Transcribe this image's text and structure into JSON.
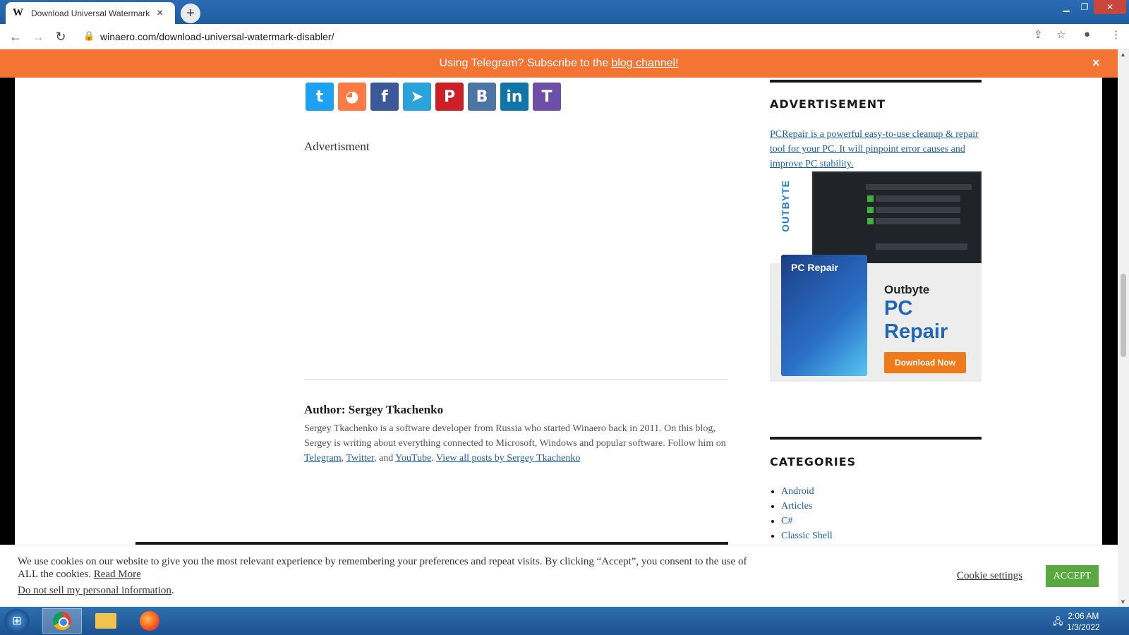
{
  "browser": {
    "tab_title": "Download Universal Watermark D",
    "favicon": "W",
    "url": "winaero.com/download-universal-watermark-disabler/"
  },
  "banner": {
    "text": "Using Telegram? Subscribe to the",
    "link": "blog channel!",
    "close": "×"
  },
  "share_buttons": [
    {
      "name": "twitter-icon",
      "color": "#1da1f2",
      "glyph": "🐦"
    },
    {
      "name": "reddit-icon",
      "color": "#ff7a45",
      "glyph": "◕"
    },
    {
      "name": "facebook-icon",
      "color": "#3b5998",
      "glyph": "f"
    },
    {
      "name": "telegram-icon",
      "color": "#2aa3dd",
      "glyph": "➤"
    },
    {
      "name": "pinterest-icon",
      "color": "#cb2027",
      "glyph": "P"
    },
    {
      "name": "vk-icon",
      "color": "#4c75a3",
      "glyph": "B"
    },
    {
      "name": "linkedin-icon",
      "color": "#0e76a8",
      "glyph": "in"
    },
    {
      "name": "tumblr-icon",
      "color": "#6d4fa8",
      "glyph": "T"
    }
  ],
  "main": {
    "advertisement_label": "Advertisment",
    "author_title": "Author: Sergey Tkachenko",
    "author_bio": "Sergey Tkachenko is a software developer from Russia who started Winaero back in 2011. On this blog, Sergey is writing about everything connected to Microsoft, Windows and popular software. Follow him on",
    "links": {
      "telegram": "Telegram",
      "twitter": "Twitter",
      "and": ", and",
      "youtube": "YouTube",
      "view_all": "View all posts by Sergey Tkachenko"
    }
  },
  "sidebar": {
    "ad_heading": "ADVERTISEMENT",
    "ad_text": "PCRepair is a powerful easy-to-use cleanup & repair tool for your PC. It will pinpoint error causes and improve PC stability.",
    "ad_image": {
      "brand_vertical": "OUTBYTE",
      "box_title": "PC Repair",
      "product_line1": "Outbyte",
      "product_line2": "PC",
      "product_line3": "Repair",
      "button": "Download Now"
    },
    "categories_heading": "CATEGORIES",
    "categories": [
      "Android",
      "Articles",
      "C#",
      "Classic Shell"
    ]
  },
  "cookie": {
    "text": "We use cookies on our website to give you the most relevant experience by remembering your preferences and repeat visits. By clicking “Accept”, you consent to the use of ALL the cookies.",
    "read_more": "Read More",
    "do_not_sell": "Do not sell my personal information",
    "settings": "Cookie settings",
    "accept": "ACCEPT"
  },
  "taskbar": {
    "time": "2:06 AM",
    "date": "1/3/2022"
  }
}
